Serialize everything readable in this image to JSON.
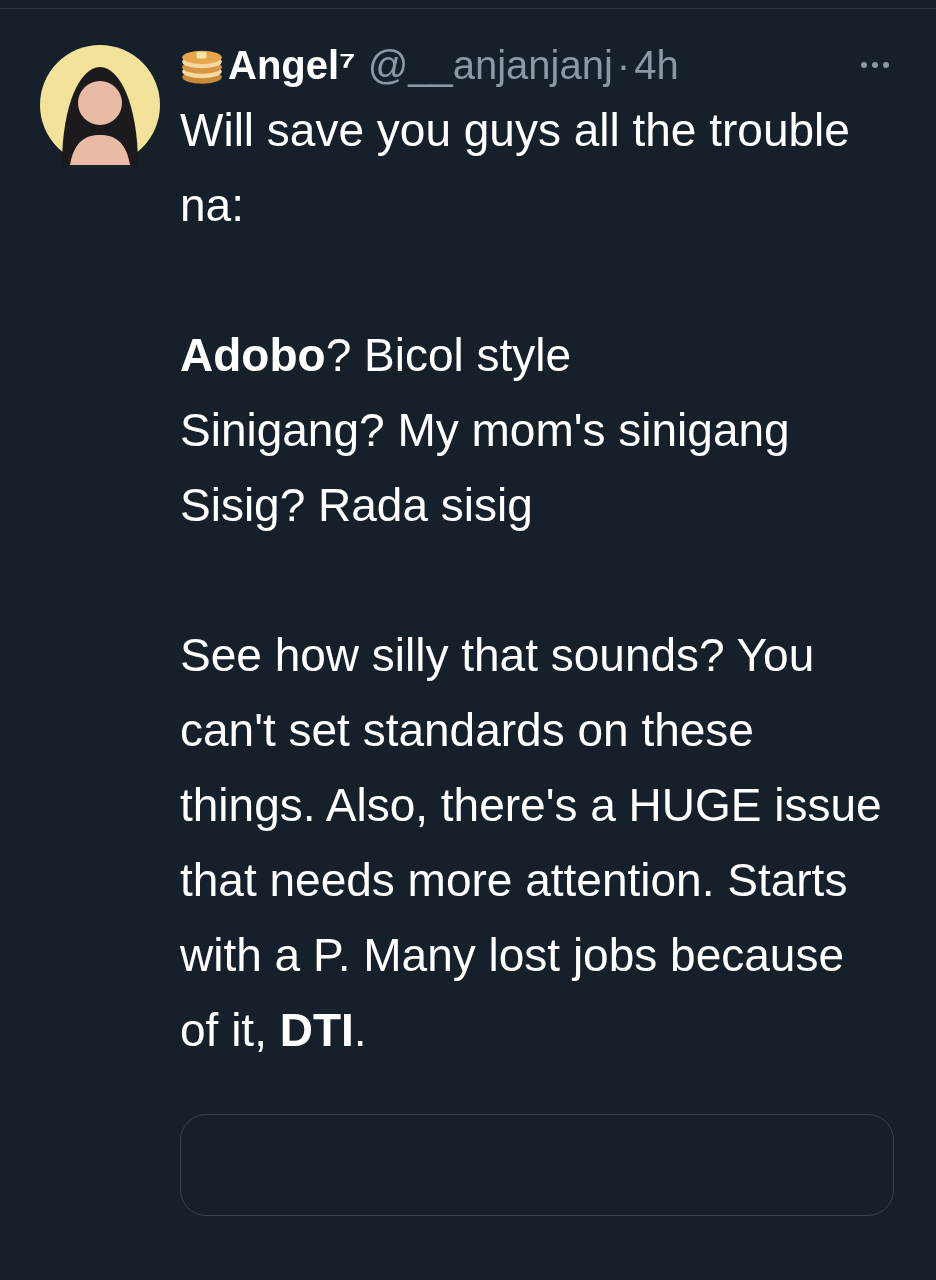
{
  "tweet": {
    "author": {
      "name": "Angel⁷",
      "handle": "@__anjanjanj"
    },
    "separator": "·",
    "time": "4h",
    "paragraphs": [
      "Will save you guys all the trouble na:",
      "**Adobo**? Bicol style\nSinigang? My mom's sinigang\nSisig? Rada sisig",
      "See how silly that sounds? You can't set standards on these things. Also, there's a HUGE issue that needs more attention. Starts with a P. Many lost jobs because of it, **DTI**."
    ]
  }
}
